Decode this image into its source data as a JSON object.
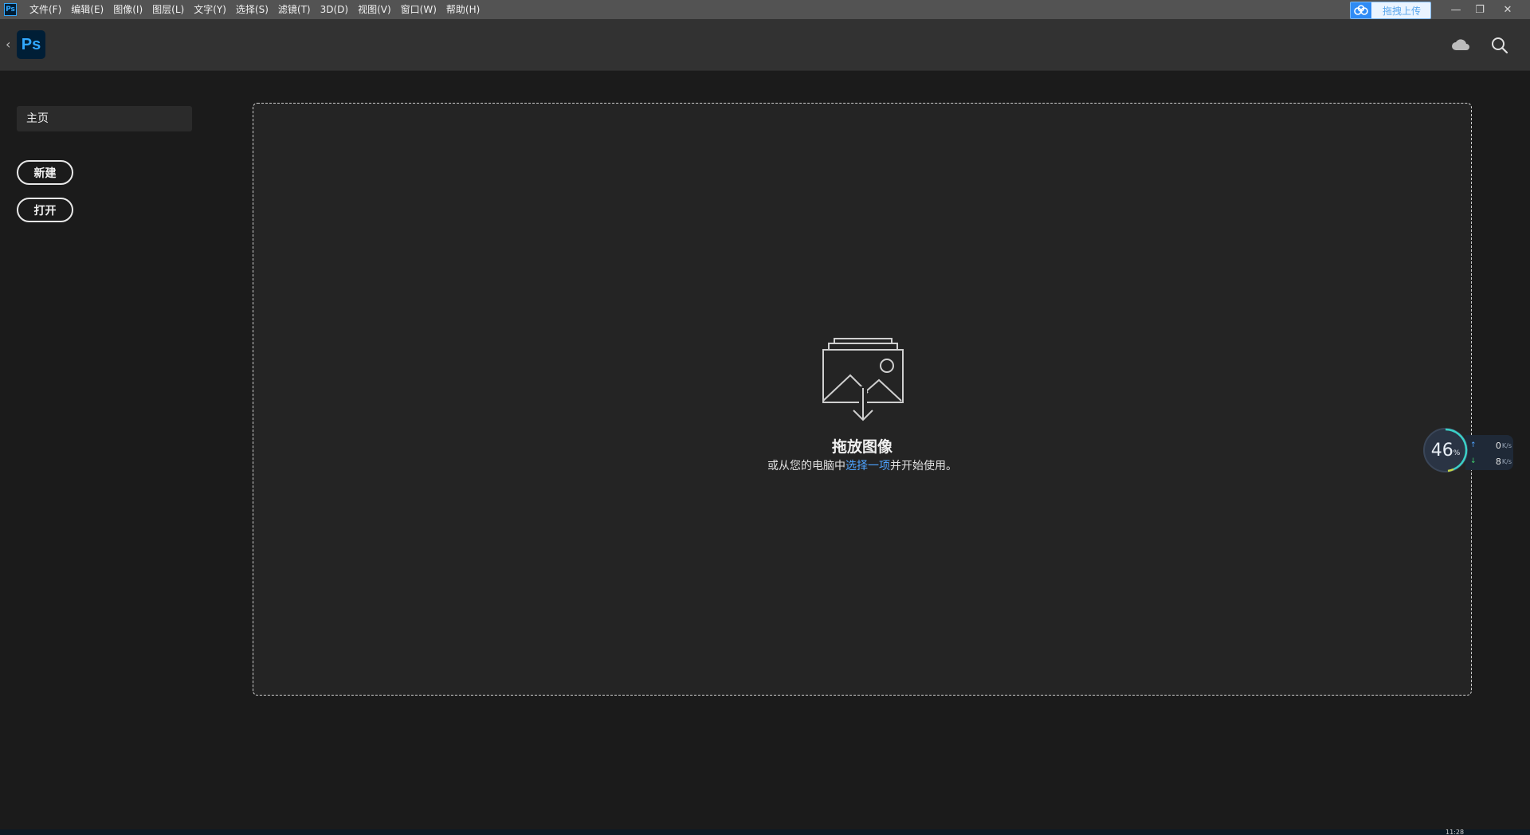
{
  "menubar": {
    "app_badge": "Ps",
    "items": [
      "文件(F)",
      "编辑(E)",
      "图像(I)",
      "图层(L)",
      "文字(Y)",
      "选择(S)",
      "滤镜(T)",
      "3D(D)",
      "视图(V)",
      "窗口(W)",
      "帮助(H)"
    ],
    "upload_label": "拖拽上传",
    "win_minimize": "—",
    "win_restore": "❐",
    "win_close": "✕"
  },
  "header": {
    "back_icon": "‹",
    "logo_text": "Ps",
    "icons": [
      "cloud-icon",
      "search-icon"
    ]
  },
  "sidebar": {
    "home_label": "主页",
    "new_label": "新建",
    "open_label": "打开"
  },
  "dropzone": {
    "title": "拖放图像",
    "sub_prefix": "或从您的电脑中",
    "sub_link": "选择一项",
    "sub_suffix": "并开始使用。",
    "icon": "image-drop-icon"
  },
  "net_widget": {
    "percent": "46",
    "percent_unit": "%",
    "upload_value": "0",
    "download_value": "8",
    "unit": "K/s",
    "up_arrow": "↑",
    "down_arrow": "↓"
  },
  "taskbar": {
    "clock_peek": "11:28"
  },
  "colors": {
    "menubar_bg": "#535353",
    "header_bg": "#323232",
    "body_bg": "#1b1b1b",
    "ps_blue": "#31a8ff",
    "ps_dark": "#001e36",
    "link": "#4da3ff"
  }
}
